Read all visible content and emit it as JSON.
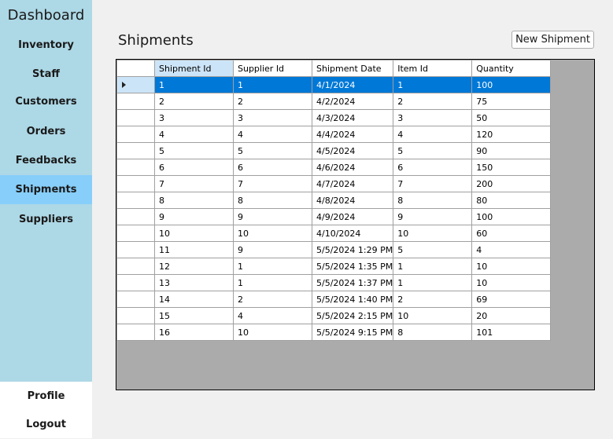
{
  "sidebar": {
    "title": "Dashboard",
    "items": [
      {
        "label": "Inventory"
      },
      {
        "label": "Staff"
      },
      {
        "label": "Customers"
      },
      {
        "label": "Orders"
      },
      {
        "label": "Feedbacks"
      },
      {
        "label": "Shipments"
      },
      {
        "label": "Suppliers"
      }
    ],
    "active": "Shipments",
    "bottom": [
      {
        "label": "Profile"
      },
      {
        "label": "Logout"
      }
    ]
  },
  "main": {
    "title": "Shipments",
    "new_button_label": "New Shipment"
  },
  "grid": {
    "columns": [
      "Shipment Id",
      "Supplier Id",
      "Shipment Date",
      "Item Id",
      "Quantity"
    ],
    "sorted_column": "Shipment Id",
    "selected_row": 0,
    "rows": [
      [
        "1",
        "1",
        "4/1/2024",
        "1",
        "100"
      ],
      [
        "2",
        "2",
        "4/2/2024",
        "2",
        "75"
      ],
      [
        "3",
        "3",
        "4/3/2024",
        "3",
        "50"
      ],
      [
        "4",
        "4",
        "4/4/2024",
        "4",
        "120"
      ],
      [
        "5",
        "5",
        "4/5/2024",
        "5",
        "90"
      ],
      [
        "6",
        "6",
        "4/6/2024",
        "6",
        "150"
      ],
      [
        "7",
        "7",
        "4/7/2024",
        "7",
        "200"
      ],
      [
        "8",
        "8",
        "4/8/2024",
        "8",
        "80"
      ],
      [
        "9",
        "9",
        "4/9/2024",
        "9",
        "100"
      ],
      [
        "10",
        "10",
        "4/10/2024",
        "10",
        "60"
      ],
      [
        "11",
        "9",
        "5/5/2024 1:29 PM",
        "5",
        "4"
      ],
      [
        "12",
        "1",
        "5/5/2024 1:35 PM",
        "1",
        "10"
      ],
      [
        "13",
        "1",
        "5/5/2024 1:37 PM",
        "1",
        "10"
      ],
      [
        "14",
        "2",
        "5/5/2024 1:40 PM",
        "2",
        "69"
      ],
      [
        "15",
        "4",
        "5/5/2024 2:15 PM",
        "10",
        "20"
      ],
      [
        "16",
        "10",
        "5/5/2024 9:15 PM",
        "8",
        "101"
      ]
    ]
  },
  "colors": {
    "sidebar_bg": "#add8e6",
    "sidebar_active": "#87cefa",
    "selection": "#0078d7"
  }
}
